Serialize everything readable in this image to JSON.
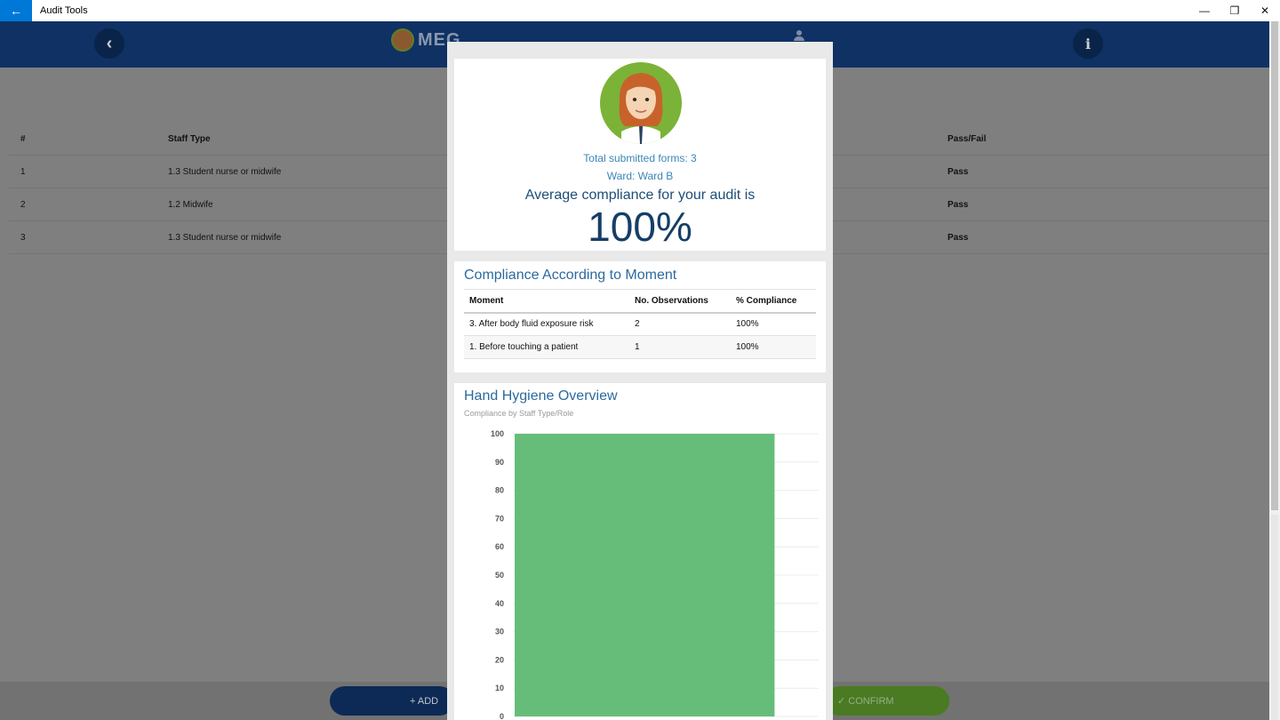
{
  "window": {
    "title": "Audit Tools",
    "back_glyph": "←",
    "controls": {
      "minimize": "—",
      "restore": "❐",
      "close": "✕"
    }
  },
  "header": {
    "logo_text": "MEG",
    "back_glyph": "‹",
    "info_glyph": "i"
  },
  "table": {
    "headers": [
      "#",
      "Staff Type",
      "Pass/Fail"
    ],
    "rows": [
      {
        "num": "1",
        "staff": "1.3 Student nurse or midwife",
        "result": "Pass"
      },
      {
        "num": "2",
        "staff": "1.2 Midwife",
        "result": "Pass"
      },
      {
        "num": "3",
        "staff": "1.3 Student nurse or midwife",
        "result": "Pass"
      }
    ]
  },
  "footer": {
    "add_label": "+ ADD",
    "confirm_label": "✓ CONFIRM"
  },
  "modal": {
    "summary": {
      "total_forms": "Total submitted forms: 3",
      "ward": "Ward: Ward B",
      "avg_label": "Average compliance for your audit is",
      "avg_value": "100%"
    },
    "moments": {
      "title": "Compliance According to Moment",
      "headers": [
        "Moment",
        "No. Observations",
        "% Compliance"
      ],
      "rows": [
        {
          "moment": "3. After body fluid exposure risk",
          "obs": "2",
          "pct": "100%"
        },
        {
          "moment": "1. Before touching a patient",
          "obs": "1",
          "pct": "100%"
        }
      ]
    },
    "overview": {
      "title": "Hand Hygiene Overview",
      "subtitle": "Compliance by Staff Type/Role"
    }
  },
  "colors": {
    "header_bg": "#0f3164",
    "bar": "#66bd7a",
    "accent_text": "#3a86b8"
  },
  "chart_data": {
    "type": "bar",
    "title": "Hand Hygiene Overview",
    "subtitle": "Compliance by Staff Type/Role",
    "categories": [
      ""
    ],
    "values": [
      100
    ],
    "ylim": [
      0,
      100
    ],
    "yticks": [
      0,
      10,
      20,
      30,
      40,
      50,
      60,
      70,
      80,
      90,
      100
    ],
    "grid": true
  }
}
